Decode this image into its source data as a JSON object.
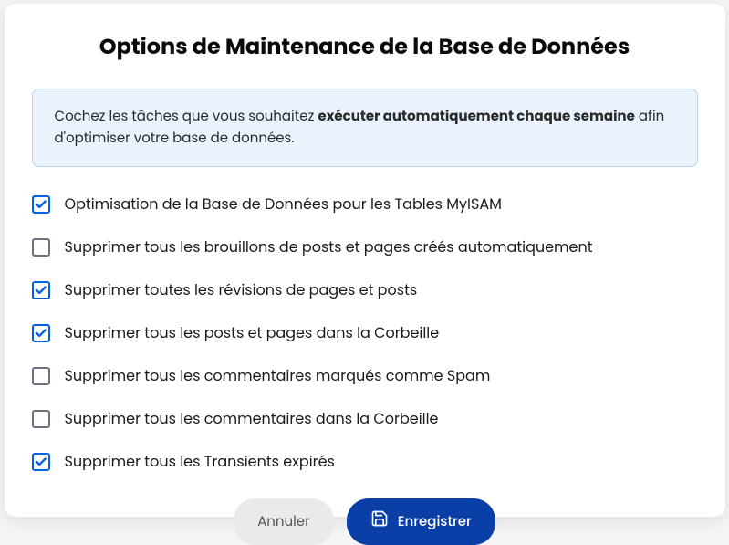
{
  "title": "Options de Maintenance de la Base de Données",
  "info": {
    "prefix": "Cochez les tâches que vous souhaitez ",
    "bold": "exécuter automatiquement chaque semaine",
    "suffix": " afin d'optimiser votre base de données."
  },
  "options": [
    {
      "checked": true,
      "label": "Optimisation de la Base de Données pour les Tables MyISAM"
    },
    {
      "checked": false,
      "label": "Supprimer tous les brouillons de posts et pages créés automatiquement"
    },
    {
      "checked": true,
      "label": "Supprimer toutes les révisions de pages et posts"
    },
    {
      "checked": true,
      "label": "Supprimer tous les posts et pages dans la Corbeille"
    },
    {
      "checked": false,
      "label": "Supprimer tous les commentaires marqués comme Spam"
    },
    {
      "checked": false,
      "label": "Supprimer tous les commentaires dans la Corbeille"
    },
    {
      "checked": true,
      "label": "Supprimer tous les Transients expirés"
    }
  ],
  "buttons": {
    "cancel": "Annuler",
    "save": "Enregistrer"
  }
}
